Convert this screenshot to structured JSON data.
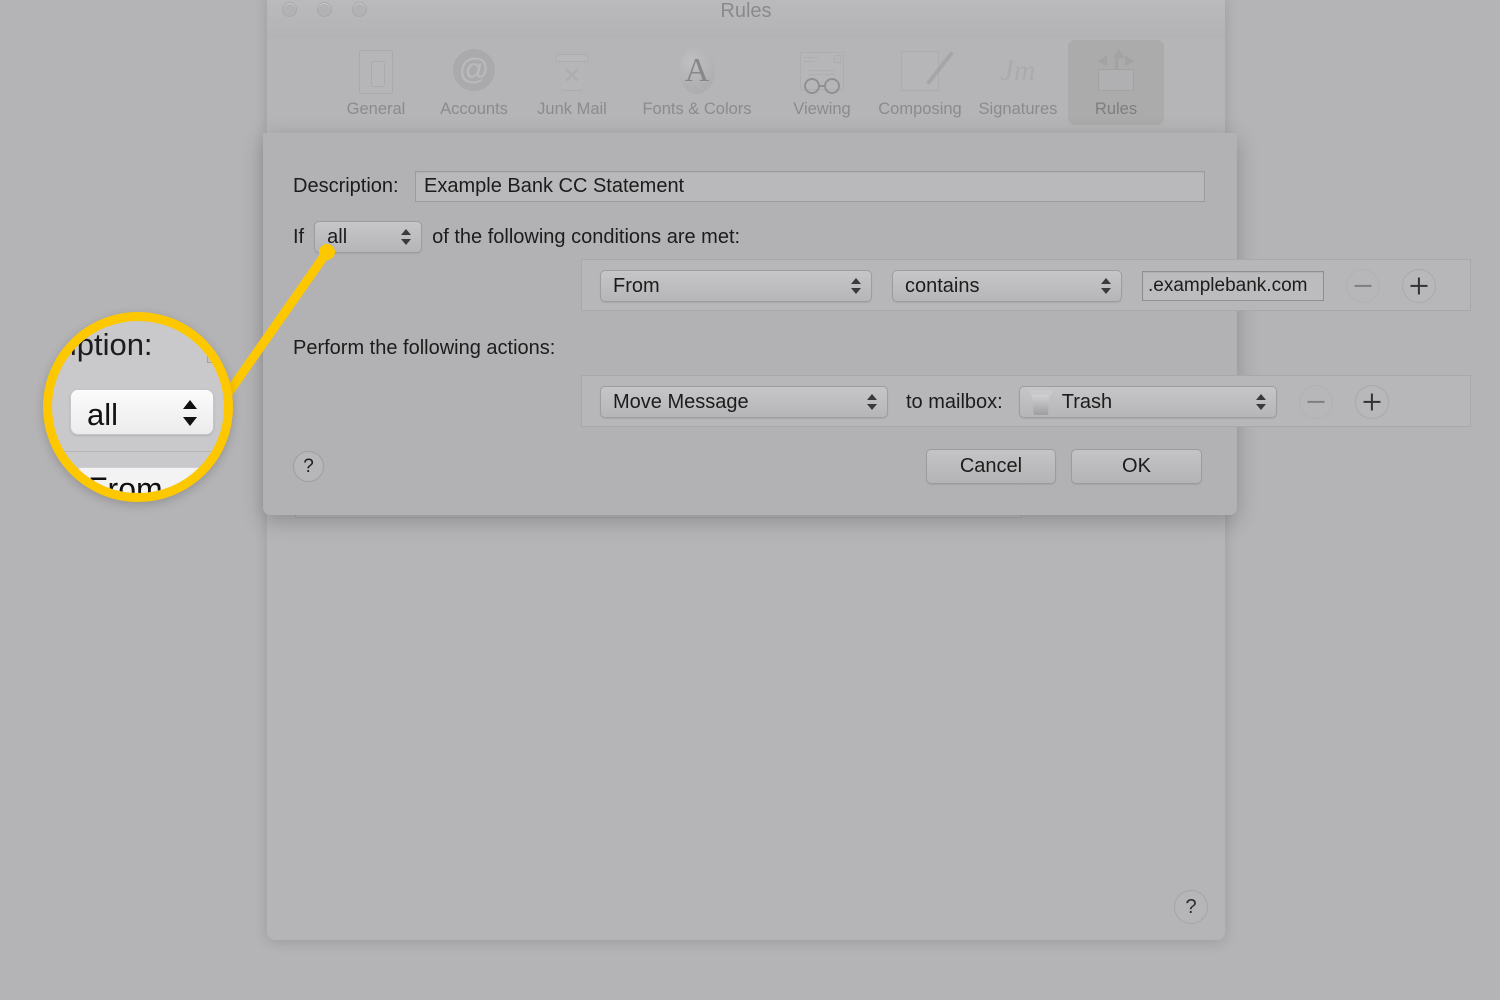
{
  "window": {
    "title": "Rules",
    "traffic_lights": [
      "close",
      "minimize",
      "zoom"
    ],
    "help_button": "?"
  },
  "toolbar": {
    "items": [
      {
        "label": "General",
        "icon": "general-switch-icon",
        "selected": false
      },
      {
        "label": "Accounts",
        "icon": "at-sign-icon",
        "selected": false
      },
      {
        "label": "Junk Mail",
        "icon": "junk-trash-icon",
        "selected": false
      },
      {
        "label": "Fonts & Colors",
        "icon": "font-a-icon",
        "selected": false
      },
      {
        "label": "Viewing",
        "icon": "eyeglasses-icon",
        "selected": false
      },
      {
        "label": "Composing",
        "icon": "pencil-paper-icon",
        "selected": false
      },
      {
        "label": "Signatures",
        "icon": "signature-icon",
        "selected": false
      },
      {
        "label": "Rules",
        "icon": "rules-envelope-icon",
        "selected": true
      }
    ]
  },
  "dialog": {
    "description": {
      "label": "Description:",
      "value": "Example Bank CC Statement"
    },
    "if_row": {
      "prefix": "If",
      "match_value": "all",
      "suffix": "of the following conditions are met:"
    },
    "condition": {
      "field": "From",
      "operator": "contains",
      "value": ".examplebank.com",
      "remove_label": "−",
      "add_label": "+",
      "remove_enabled": false
    },
    "perform_label": "Perform the following actions:",
    "action": {
      "type": "Move Message",
      "middle_label": "to mailbox:",
      "mailbox": "Trash",
      "mailbox_icon": "trash-can-icon",
      "remove_label": "−",
      "add_label": "+",
      "remove_enabled": false
    },
    "help_button": "?",
    "cancel_label": "Cancel",
    "ok_label": "OK"
  },
  "callout": {
    "color": "#fdc800",
    "magnified": {
      "description_label": "cription:",
      "popup_value": "all",
      "below_value": "From"
    }
  }
}
